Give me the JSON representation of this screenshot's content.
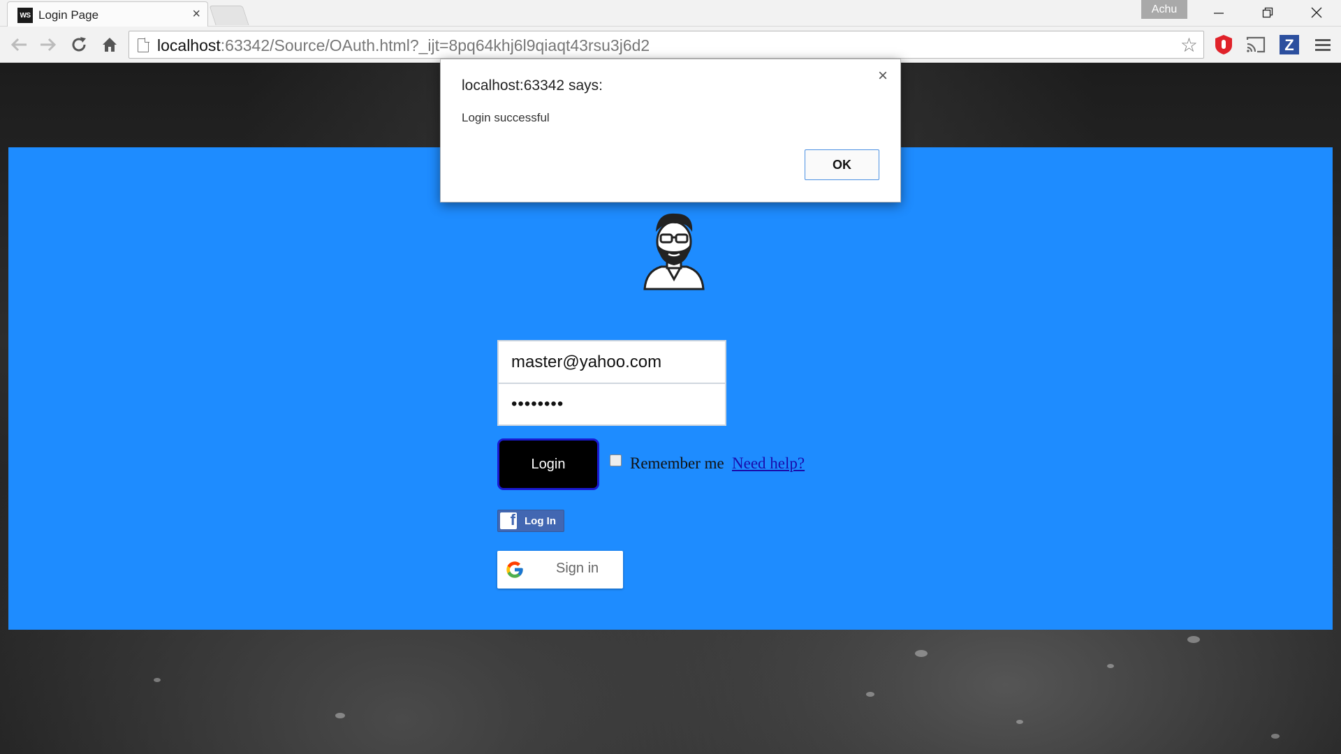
{
  "browser": {
    "tab_title": "Login Page",
    "tab_favicon": "WS",
    "tab_close": "×",
    "profile_name": "Achu",
    "url_host": "localhost",
    "url_rest": ":63342/Source/OAuth.html?_ijt=8pq64khj6l9qiaqt43rsu3j6d2",
    "window_controls": {
      "minimize": "—",
      "restore": "❐",
      "close": "✕"
    }
  },
  "dialog": {
    "title": "localhost:63342 says:",
    "message": "Login successful",
    "ok_label": "OK",
    "close_glyph": "×"
  },
  "login_form": {
    "email_value": "master@yahoo.com",
    "password_value": "••••••••",
    "login_button": "Login",
    "remember_label": "Remember me",
    "remember_checked": false,
    "help_link": "Need help? ",
    "facebook_button": "Log In",
    "google_button": "Sign in"
  },
  "colors": {
    "panel": "#1e8cff",
    "login_button": "#000000",
    "facebook": "#4267b2",
    "link": "#1a0dab"
  },
  "icons": [
    "back-arrow-icon",
    "forward-arrow-icon",
    "reload-icon",
    "home-icon",
    "page-icon",
    "star-icon",
    "adblock-icon",
    "cast-icon",
    "zotero-icon",
    "menu-icon",
    "avatar-icon",
    "facebook-icon",
    "google-icon"
  ]
}
